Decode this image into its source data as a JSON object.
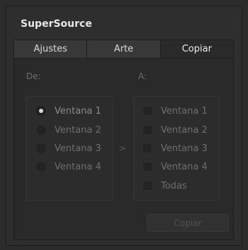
{
  "panel": {
    "title": "SuperSource"
  },
  "tabs": [
    {
      "label": "Ajustes",
      "active": false
    },
    {
      "label": "Arte",
      "active": false
    },
    {
      "label": "Copiar",
      "active": true
    }
  ],
  "copy": {
    "from_label": "De:",
    "to_label": "A:",
    "from_options": [
      {
        "label": "Ventana 1",
        "selected": true
      },
      {
        "label": "Ventana 2",
        "selected": false
      },
      {
        "label": "Ventana 3",
        "selected": false
      },
      {
        "label": "Ventana 4",
        "selected": false
      }
    ],
    "arrow_icon": "chevron-right-icon",
    "arrow_glyph": ">",
    "to_options": [
      {
        "label": "Ventana 1",
        "checked": false
      },
      {
        "label": "Ventana 2",
        "checked": false
      },
      {
        "label": "Ventana 3",
        "checked": false
      },
      {
        "label": "Ventana 4",
        "checked": false
      },
      {
        "label": "Todas",
        "checked": false
      }
    ],
    "button_label": "Copiar"
  }
}
